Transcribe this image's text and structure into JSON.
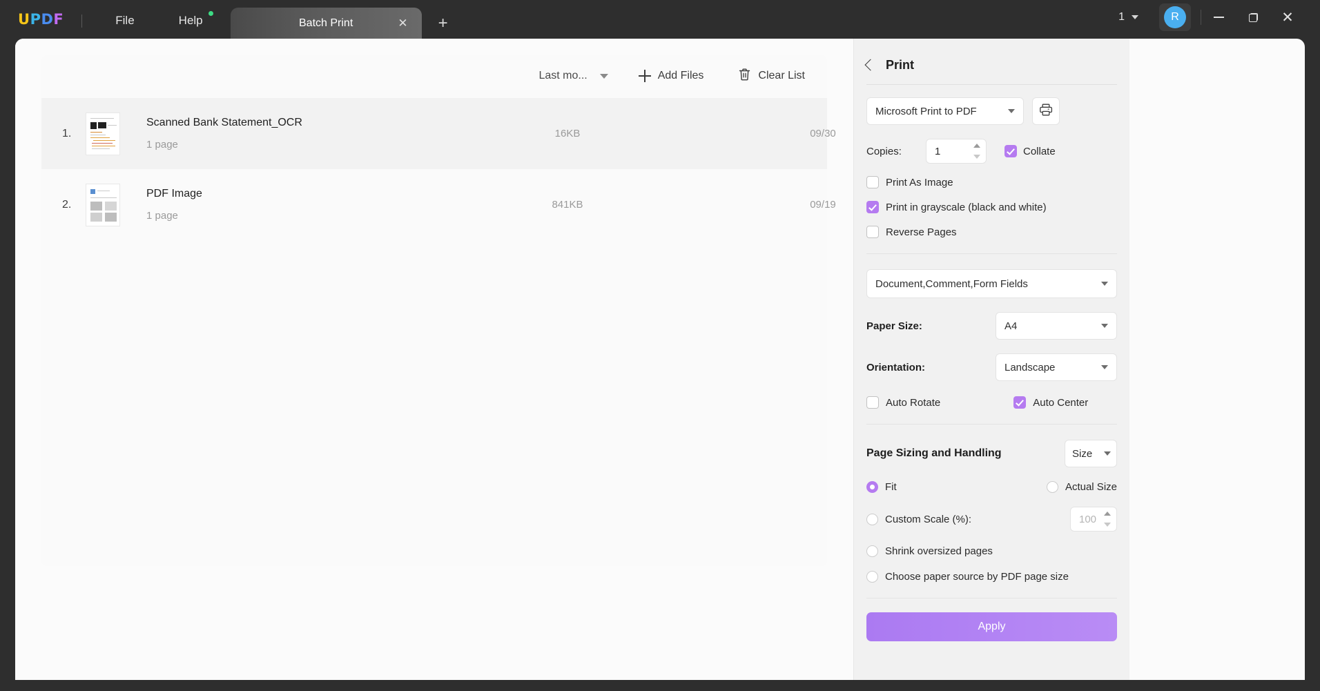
{
  "titlebar": {
    "logo": {
      "l1": "U",
      "l2": "P",
      "l3": "D",
      "l4": "F"
    },
    "menus": [
      {
        "label": "File",
        "name": "menu-file"
      },
      {
        "label": "Help",
        "name": "menu-help",
        "badge": true
      }
    ],
    "tab": {
      "label": "Batch Print",
      "close": "✕"
    },
    "new_tab": "+",
    "page_count": "1",
    "avatar_initial": "R",
    "window_controls": {
      "minimize": "minimize",
      "maximize": "restore",
      "close": "✕"
    }
  },
  "file_list": {
    "sort_label": "Last mo...",
    "add_files_label": "Add Files",
    "clear_list_label": "Clear List",
    "rows": [
      {
        "index": "1.",
        "name": "Scanned Bank Statement_OCR",
        "pages": "1 page",
        "size": "16KB",
        "date": "09/30",
        "selected": true
      },
      {
        "index": "2.",
        "name": "PDF Image",
        "pages": "1 page",
        "size": "841KB",
        "date": "09/19",
        "selected": false
      }
    ]
  },
  "print_panel": {
    "title": "Print",
    "printer": {
      "value": "Microsoft Print to PDF"
    },
    "copies": {
      "label": "Copies:",
      "value": "1"
    },
    "collate": {
      "label": "Collate",
      "checked": true
    },
    "print_as_image": {
      "label": "Print As Image",
      "checked": false
    },
    "print_grayscale": {
      "label": "Print in grayscale (black and white)",
      "checked": true
    },
    "reverse_pages": {
      "label": "Reverse Pages",
      "checked": false
    },
    "content_select": {
      "value": "Document,Comment,Form Fields"
    },
    "paper_size": {
      "label": "Paper Size:",
      "value": "A4"
    },
    "orientation": {
      "label": "Orientation:",
      "value": "Landscape"
    },
    "auto_rotate": {
      "label": "Auto Rotate",
      "checked": false
    },
    "auto_center": {
      "label": "Auto Center",
      "checked": true
    },
    "sizing_section": {
      "title": "Page Sizing and Handling",
      "mode": "Size"
    },
    "fit": {
      "label": "Fit",
      "selected": true
    },
    "actual_size": {
      "label": "Actual Size",
      "selected": false
    },
    "custom_scale": {
      "label": "Custom Scale (%):",
      "selected": false,
      "value": "100"
    },
    "shrink_oversized": {
      "label": "Shrink oversized pages",
      "selected": false
    },
    "choose_paper_source": {
      "label": "Choose paper source by PDF page size",
      "selected": false
    },
    "apply_label": "Apply"
  },
  "colors": {
    "accent_purple": "#b57bf0",
    "apply_gradient_from": "#ab7af2",
    "apply_gradient_to": "#b98cf5",
    "titlebar_bg": "#2e2e2e",
    "panel_bg": "#f1f1f1",
    "avatar_blue": "#4aaff0",
    "help_badge_green": "#3ddc84"
  }
}
